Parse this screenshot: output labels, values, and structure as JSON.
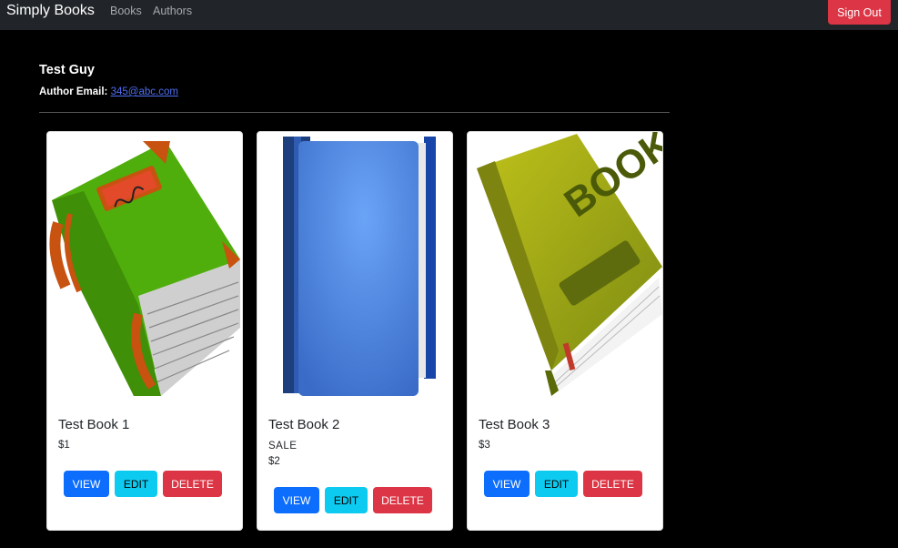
{
  "navbar": {
    "brand": "Simply Books",
    "links": [
      "Books",
      "Authors"
    ],
    "signout_label": "Sign Out"
  },
  "author": {
    "name": "Test Guy",
    "email_label": "Author Email:",
    "email": "345@abc.com"
  },
  "books": [
    {
      "title": "Test Book 1",
      "sale": "",
      "price": "$1",
      "cover": "green-book-icon"
    },
    {
      "title": "Test Book 2",
      "sale": "SALE",
      "price": "$2",
      "cover": "blue-book-icon"
    },
    {
      "title": "Test Book 3",
      "sale": "",
      "price": "$3",
      "cover": "olive-book-icon"
    }
  ],
  "buttons": {
    "view": "VIEW",
    "edit": "EDIT",
    "delete": "DELETE"
  },
  "cover_text": "BOOK",
  "colors": {
    "navbar": "#212529",
    "primary": "#0d6efd",
    "info": "#0dcaf0",
    "danger": "#dc3545"
  }
}
